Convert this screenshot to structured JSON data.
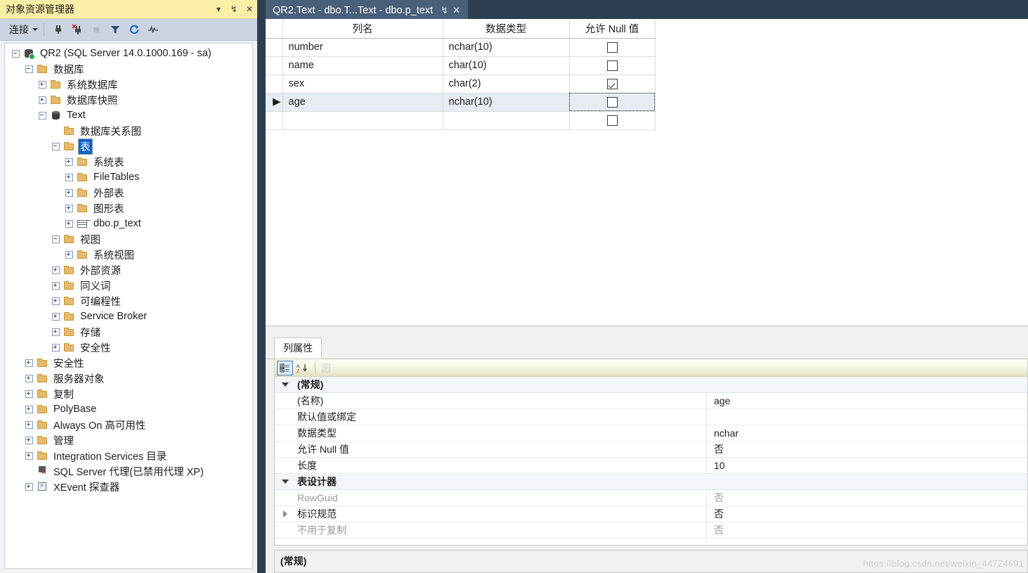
{
  "object_explorer": {
    "title": "对象资源管理器",
    "titlebar_buttons": [
      {
        "name": "dropdown-icon",
        "glyph": "▾"
      },
      {
        "name": "pin-icon",
        "glyph": "↯"
      },
      {
        "name": "close-icon",
        "glyph": "✕"
      }
    ],
    "toolbar": {
      "connect_label": "连接",
      "buttons": [
        {
          "name": "connect-object-explorer-icon",
          "glyph": "⑂"
        },
        {
          "name": "disconnect-object-explorer-icon",
          "glyph": "⑂"
        },
        {
          "name": "stop-icon",
          "glyph": "■"
        },
        {
          "name": "filter-icon",
          "glyph": "▼"
        },
        {
          "name": "refresh-icon",
          "glyph": "↻"
        },
        {
          "name": "activity-monitor-icon",
          "glyph": "∿"
        }
      ]
    },
    "tree": [
      {
        "label": "QR2 (SQL Server 14.0.1000.169 - sa)",
        "depth": 0,
        "state": "minus",
        "icon": "server",
        "selected": false
      },
      {
        "label": "数据库",
        "depth": 1,
        "state": "minus",
        "icon": "folder",
        "selected": false
      },
      {
        "label": "系统数据库",
        "depth": 2,
        "state": "plus",
        "icon": "folder",
        "selected": false
      },
      {
        "label": "数据库快照",
        "depth": 2,
        "state": "plus",
        "icon": "folder",
        "selected": false
      },
      {
        "label": "Text",
        "depth": 2,
        "state": "minus",
        "icon": "db",
        "selected": false
      },
      {
        "label": "数据库关系图",
        "depth": 3,
        "state": "none",
        "icon": "folder",
        "selected": false
      },
      {
        "label": "表",
        "depth": 3,
        "state": "minus",
        "icon": "folder",
        "selected": true
      },
      {
        "label": "系统表",
        "depth": 4,
        "state": "plus",
        "icon": "folder",
        "selected": false
      },
      {
        "label": "FileTables",
        "depth": 4,
        "state": "plus",
        "icon": "folder",
        "selected": false
      },
      {
        "label": "外部表",
        "depth": 4,
        "state": "plus",
        "icon": "folder",
        "selected": false
      },
      {
        "label": "图形表",
        "depth": 4,
        "state": "plus",
        "icon": "folder",
        "selected": false
      },
      {
        "label": "dbo.p_text",
        "depth": 4,
        "state": "plus",
        "icon": "table",
        "selected": false
      },
      {
        "label": "视图",
        "depth": 3,
        "state": "minus",
        "icon": "folder",
        "selected": false
      },
      {
        "label": "系统视图",
        "depth": 4,
        "state": "plus",
        "icon": "folder",
        "selected": false
      },
      {
        "label": "外部资源",
        "depth": 3,
        "state": "plus",
        "icon": "folder",
        "selected": false
      },
      {
        "label": "同义词",
        "depth": 3,
        "state": "plus",
        "icon": "folder",
        "selected": false
      },
      {
        "label": "可编程性",
        "depth": 3,
        "state": "plus",
        "icon": "folder",
        "selected": false
      },
      {
        "label": "Service Broker",
        "depth": 3,
        "state": "plus",
        "icon": "folder",
        "selected": false
      },
      {
        "label": "存储",
        "depth": 3,
        "state": "plus",
        "icon": "folder",
        "selected": false
      },
      {
        "label": "安全性",
        "depth": 3,
        "state": "plus",
        "icon": "folder",
        "selected": false
      },
      {
        "label": "安全性",
        "depth": 1,
        "state": "plus",
        "icon": "folder",
        "selected": false
      },
      {
        "label": "服务器对象",
        "depth": 1,
        "state": "plus",
        "icon": "folder",
        "selected": false
      },
      {
        "label": "复制",
        "depth": 1,
        "state": "plus",
        "icon": "folder",
        "selected": false
      },
      {
        "label": "PolyBase",
        "depth": 1,
        "state": "plus",
        "icon": "folder",
        "selected": false
      },
      {
        "label": "Always On 高可用性",
        "depth": 1,
        "state": "plus",
        "icon": "folder",
        "selected": false
      },
      {
        "label": "管理",
        "depth": 1,
        "state": "plus",
        "icon": "folder",
        "selected": false
      },
      {
        "label": "Integration Services 目录",
        "depth": 1,
        "state": "plus",
        "icon": "folder",
        "selected": false
      },
      {
        "label": "SQL Server 代理(已禁用代理 XP)",
        "depth": 1,
        "state": "none",
        "icon": "agent",
        "selected": false
      },
      {
        "label": "XEvent 探查器",
        "depth": 1,
        "state": "plus",
        "icon": "xevent",
        "selected": false
      }
    ]
  },
  "document": {
    "tab": {
      "title": "QR2.Text - dbo.T...Text - dbo.p_text",
      "pin_glyph": "↯",
      "close_glyph": "✕"
    },
    "designer": {
      "headers": [
        "",
        "列名",
        "数据类型",
        "允许 Null 值"
      ],
      "rows": [
        {
          "marker": "",
          "name": "number",
          "type": "nchar(10)",
          "allow_null": false,
          "selected": false
        },
        {
          "marker": "",
          "name": "name",
          "type": "char(10)",
          "allow_null": false,
          "selected": false
        },
        {
          "marker": "",
          "name": "sex",
          "type": "char(2)",
          "allow_null": true,
          "selected": false
        },
        {
          "marker": "▶",
          "name": "age",
          "type": "nchar(10)",
          "allow_null": false,
          "selected": true
        },
        {
          "marker": "",
          "name": "",
          "type": "",
          "allow_null": false,
          "selected": false
        }
      ]
    }
  },
  "properties": {
    "tab_label": "列属性",
    "toolbar": [
      {
        "name": "categorized-view-button",
        "glyph": "☷",
        "state": "active"
      },
      {
        "name": "alphabetical-sort-button",
        "glyph": "AZ↓",
        "state": "normal"
      },
      {
        "name": "property-pages-button",
        "glyph": "▤",
        "state": "disabled"
      }
    ],
    "groups": [
      {
        "name": "(常规)",
        "expanded": true,
        "rows": [
          {
            "name": "(名称)",
            "value": "age",
            "dim": false,
            "expandable": false
          },
          {
            "name": "默认值或绑定",
            "value": "",
            "dim": false,
            "expandable": false
          },
          {
            "name": "数据类型",
            "value": "nchar",
            "dim": false,
            "expandable": false
          },
          {
            "name": "允许 Null 值",
            "value": "否",
            "dim": false,
            "expandable": false
          },
          {
            "name": "长度",
            "value": "10",
            "dim": false,
            "expandable": false
          }
        ]
      },
      {
        "name": "表设计器",
        "expanded": true,
        "rows": [
          {
            "name": "RowGuid",
            "value": "否",
            "dim": true,
            "expandable": false
          },
          {
            "name": "标识规范",
            "value": "否",
            "dim": false,
            "expandable": true
          },
          {
            "name": "不用于复制",
            "value": "否",
            "dim": true,
            "expandable": false
          }
        ]
      }
    ],
    "description_title": "(常规)"
  },
  "watermark": "https://blog.csdn.net/weixin_44724691",
  "colors": {
    "title_bar": "#fbefa5",
    "toolbar": "#ccd3e0",
    "tab_active": "#4a5f7a",
    "chrome_dark": "#2d3e50",
    "selection_blue": "#0f65c8",
    "grid_selected_row": "#e6ecf2"
  }
}
